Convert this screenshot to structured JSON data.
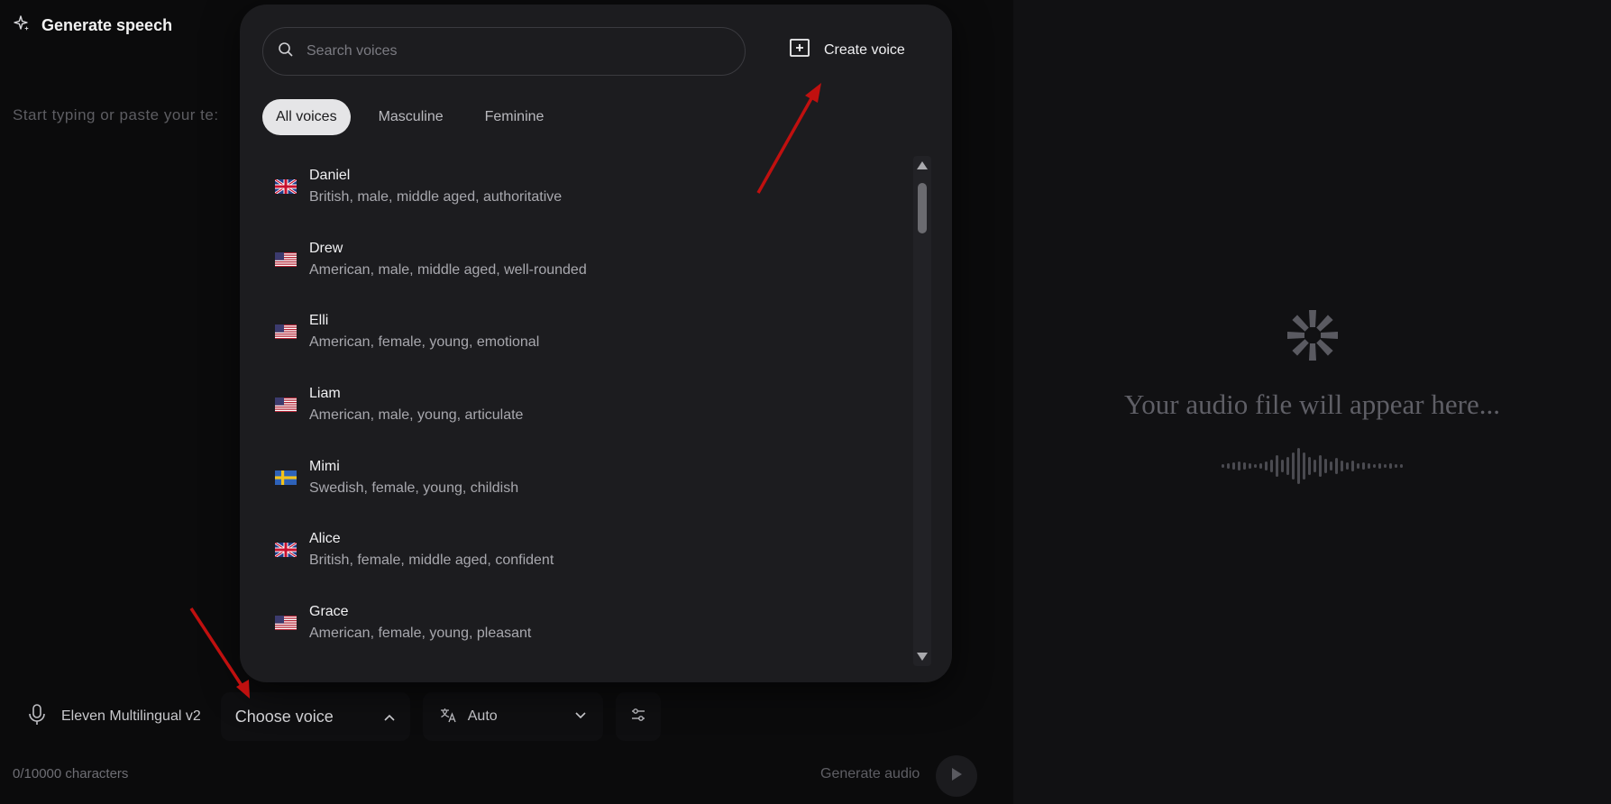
{
  "header": {
    "title": "Generate speech"
  },
  "editor": {
    "placeholder": "Start typing or paste your te:"
  },
  "bottom_bar": {
    "model": "Eleven Multilingual v2",
    "voice_selector": "Choose voice",
    "language": "Auto"
  },
  "footer": {
    "char_count": "0/10000 characters",
    "generate_label": "Generate audio"
  },
  "output_panel": {
    "empty_text": "Your audio file will appear here..."
  },
  "dropdown": {
    "search_placeholder": "Search voices",
    "create_voice_label": "Create voice",
    "filters": [
      "All voices",
      "Masculine",
      "Feminine"
    ],
    "active_filter": "All voices",
    "voices": [
      {
        "name": "Daniel",
        "desc": "British, male, middle aged, authoritative",
        "flag": "uk-flag-icon"
      },
      {
        "name": "Drew",
        "desc": "American, male, middle aged, well-rounded",
        "flag": "us-flag-icon"
      },
      {
        "name": "Elli",
        "desc": "American, female, young, emotional",
        "flag": "us-flag-icon"
      },
      {
        "name": "Liam",
        "desc": "American, male, young, articulate",
        "flag": "us-flag-icon"
      },
      {
        "name": "Mimi",
        "desc": "Swedish, female, young, childish",
        "flag": "sweden-flag-icon"
      },
      {
        "name": "Alice",
        "desc": "British, female, middle aged, confident",
        "flag": "uk-flag-icon"
      },
      {
        "name": "Grace",
        "desc": "American, female, young, pleasant",
        "flag": "us-flag-icon"
      }
    ]
  },
  "colors": {
    "background": "#0b0b0c",
    "panel": "#111113",
    "dropdown": "#1c1c1f",
    "annotation_arrow": "#c0100f"
  }
}
